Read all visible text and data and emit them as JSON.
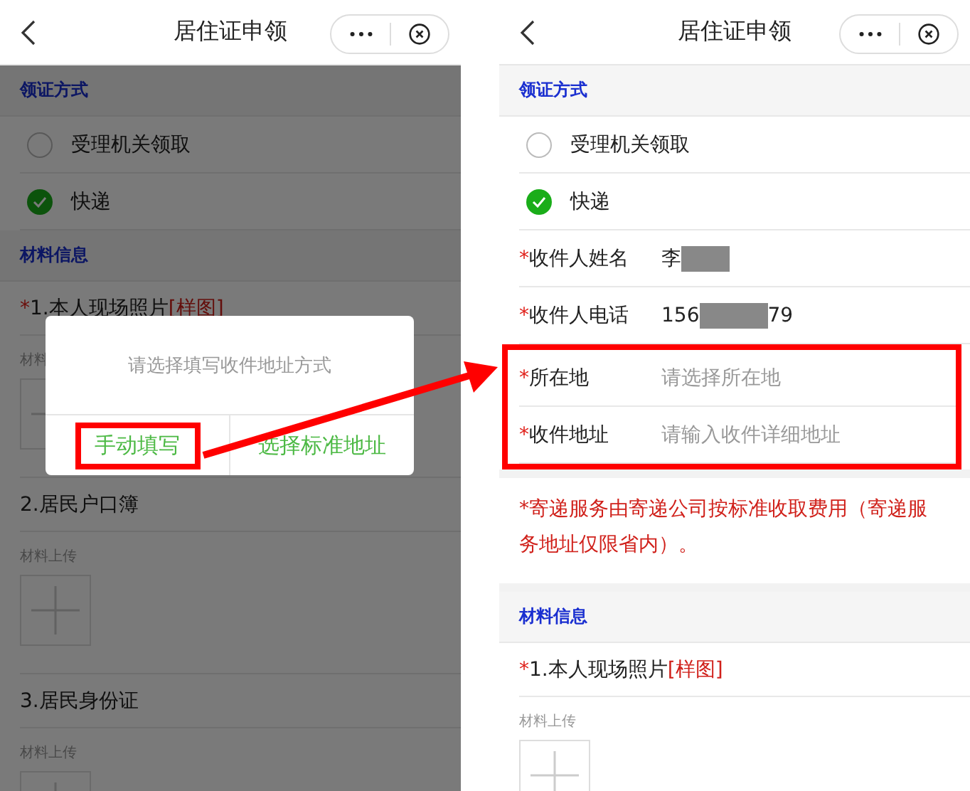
{
  "screens": [
    {
      "title": "居住证申领",
      "dimmed": true,
      "sections": [
        {
          "kind": "header",
          "label": "领证方式"
        },
        {
          "kind": "radio",
          "label": "受理机关领取",
          "selected": false
        },
        {
          "kind": "radio",
          "label": "快递",
          "selected": true
        },
        {
          "kind": "header",
          "label": "材料信息"
        },
        {
          "kind": "material",
          "mark": "*",
          "label": "1.本人现场照片",
          "link": "[样图]",
          "upload_label": "材料"
        },
        {
          "kind": "material",
          "label": "2.居民户口簿",
          "upload_label": "材料上传"
        },
        {
          "kind": "material",
          "label": "3.居民身份证",
          "upload_label": "材料上传"
        }
      ],
      "dialog": {
        "message": "请选择填写收件地址方式",
        "buttons": [
          {
            "label": "手动填写",
            "highlighted": true
          },
          {
            "label": "选择标准地址",
            "highlighted": false
          }
        ]
      }
    },
    {
      "title": "居住证申领",
      "dimmed": false,
      "sections": [
        {
          "kind": "header",
          "label": "领证方式"
        },
        {
          "kind": "radio",
          "label": "受理机关领取",
          "selected": false
        },
        {
          "kind": "radio",
          "label": "快递",
          "selected": true
        },
        {
          "kind": "field",
          "mark": "*",
          "label": "收件人姓名",
          "value": "李",
          "masked": true
        },
        {
          "kind": "field",
          "mark": "*",
          "label": "收件人电话",
          "value": "156",
          "masked": true,
          "value_end": "79"
        },
        {
          "kind": "group",
          "highlighted": true,
          "children": [
            {
              "kind": "field",
              "mark": "*",
              "label": "所在地",
              "placeholder": "请选择所在地"
            },
            {
              "kind": "field",
              "mark": "*",
              "label": "收件地址",
              "placeholder": "请输入收件详细地址"
            }
          ]
        },
        {
          "kind": "notice",
          "text": "*寄递服务由寄递公司按标准收取费用（寄递服务地址仅限省内）。"
        },
        {
          "kind": "header",
          "label": "材料信息"
        },
        {
          "kind": "material",
          "mark": "*",
          "label": "1.本人现场照片",
          "link": "[样图]",
          "upload_label": "材料上传"
        }
      ]
    }
  ]
}
